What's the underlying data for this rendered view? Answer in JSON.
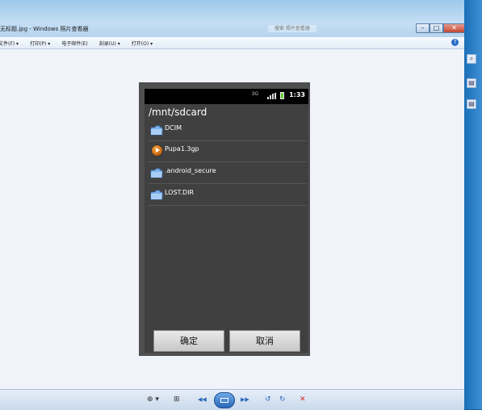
{
  "window": {
    "title": "无标题.jpg - Windows 照片查看器",
    "search_placeholder": "搜索 照片查看器",
    "minimize": "–",
    "maximize": "□",
    "close": "✕"
  },
  "menu": {
    "items": [
      "文件(F) ▾",
      "打印(P) ▾",
      "电子邮件(E)",
      "刻录(U) ▾",
      "打开(O) ▾"
    ],
    "help": "?"
  },
  "controls": {
    "zoom": "⊕ ▾",
    "actual_size": "⊞",
    "prev": "◀◀",
    "next": "▶▶",
    "rotate_ccw": "↺",
    "rotate_cw": "↻",
    "delete": "✕"
  },
  "phone": {
    "network": "3G",
    "time": "1:33",
    "path": "/mnt/sdcard",
    "files": [
      {
        "name": "DCIM",
        "type": "folder"
      },
      {
        "name": "Pupa1.3gp",
        "type": "media"
      },
      {
        "name": ".android_secure",
        "type": "folder"
      },
      {
        "name": "LOST.DIR",
        "type": "folder"
      }
    ],
    "ok_button": "确定",
    "cancel_button": "取消"
  },
  "colors": {
    "accent_blue": "#1565a8",
    "dialog_bg": "#404040",
    "phone_frame": "#4f4f4f",
    "folder_blue": "#6aa0e0",
    "media_orange": "#e0801e"
  }
}
